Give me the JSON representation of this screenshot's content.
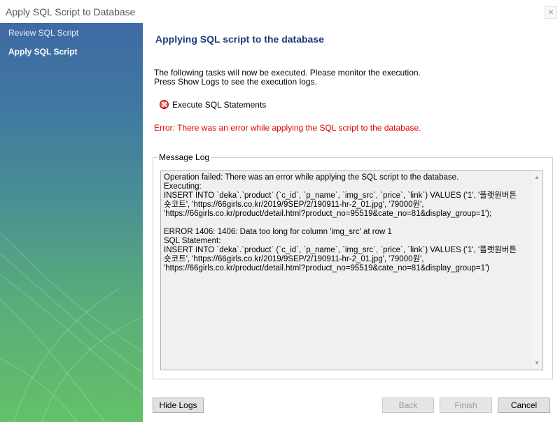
{
  "window": {
    "title": "Apply SQL Script to Database"
  },
  "sidebar": {
    "steps": [
      {
        "label": "Review SQL Script"
      },
      {
        "label": "Apply SQL Script"
      }
    ]
  },
  "main": {
    "heading": "Applying SQL script to the database",
    "intro_line1": "The following tasks will now be executed. Please monitor the execution.",
    "intro_line2": "Press Show Logs to see the execution logs.",
    "task_label": "Execute SQL Statements",
    "error_text": "Error: There was an error while applying the SQL script to the database.",
    "message_log_title": "Message Log",
    "log_text": "Operation failed: There was an error while applying the SQL script to the database.\nExecuting:\nINSERT INTO `deka`.`product` (`c_id`, `p_name`, `img_src`, `price`, `link`) VALUES ('1', '플랫원버튼\n숏코트', 'https://66girls.co.kr/2019/9SEP/2/190911-hr-2_01.jpg', '79000원',\n'https://66girls.co.kr/product/detail.html?product_no=95519&cate_no=81&display_group=1');\n\nERROR 1406: 1406: Data too long for column 'img_src' at row 1\nSQL Statement:\nINSERT INTO `deka`.`product` (`c_id`, `p_name`, `img_src`, `price`, `link`) VALUES ('1', '플랫원버튼\n숏코트', 'https://66girls.co.kr/2019/9SEP/2/190911-hr-2_01.jpg', '79000원',\n'https://66girls.co.kr/product/detail.html?product_no=95519&cate_no=81&display_group=1')"
  },
  "buttons": {
    "hide_logs": "Hide Logs",
    "back": "Back",
    "finish": "Finish",
    "cancel": "Cancel"
  },
  "icons": {
    "close": "close-icon",
    "task_status": "error-icon"
  },
  "colors": {
    "heading": "#1c3d7a",
    "error": "#e00000"
  }
}
